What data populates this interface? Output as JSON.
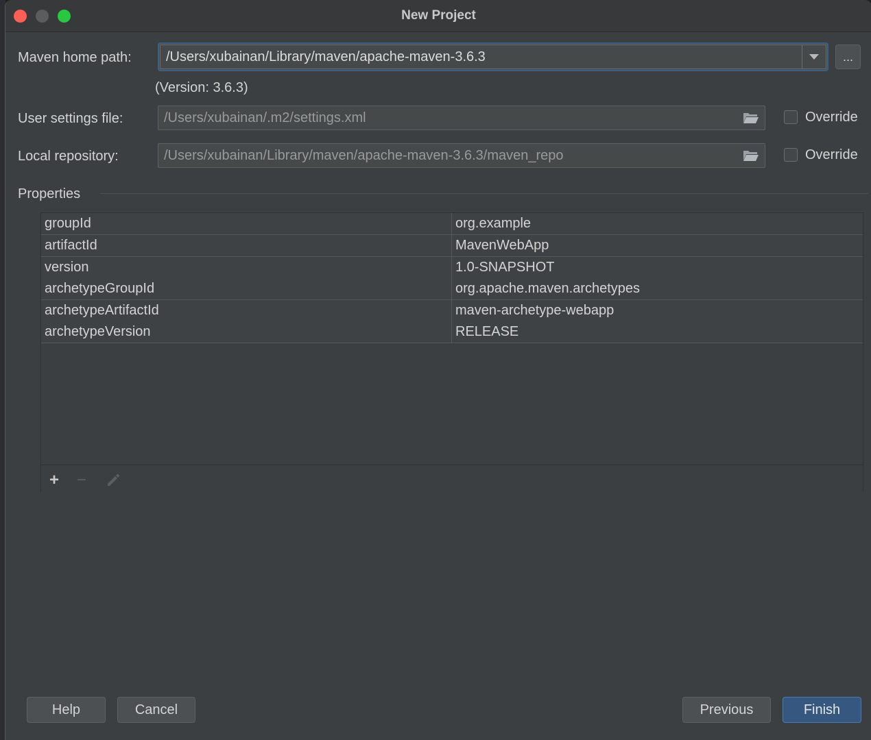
{
  "window": {
    "title": "New Project"
  },
  "maven": {
    "home_label": "Maven home path:",
    "home_value": "/Users/xubainan/Library/maven/apache-maven-3.6.3",
    "browse_label": "...",
    "version_text": "(Version: 3.6.3)",
    "settings_label": "User settings file:",
    "settings_value": "/Users/xubainan/.m2/settings.xml",
    "settings_override": "Override",
    "settings_override_checked": false,
    "repo_label": "Local repository:",
    "repo_value": "/Users/xubainan/Library/maven/apache-maven-3.6.3/maven_repo",
    "repo_override": "Override",
    "repo_override_checked": false
  },
  "properties": {
    "section_label": "Properties",
    "rows": [
      {
        "key": "groupId",
        "value": "org.example"
      },
      {
        "key": "artifactId",
        "value": "MavenWebApp"
      },
      {
        "key": "version",
        "value": "1.0-SNAPSHOT"
      },
      {
        "key": "archetypeGroupId",
        "value": "org.apache.maven.archetypes"
      },
      {
        "key": "archetypeArtifactId",
        "value": "maven-archetype-webapp"
      },
      {
        "key": "archetypeVersion",
        "value": "RELEASE"
      }
    ],
    "toolbar": {
      "add": "+",
      "remove": "−",
      "edit_icon": "pencil-icon"
    }
  },
  "buttons": {
    "help": "Help",
    "cancel": "Cancel",
    "previous": "Previous",
    "finish": "Finish"
  },
  "colors": {
    "accent": "#365880",
    "focus": "#3d6186"
  }
}
